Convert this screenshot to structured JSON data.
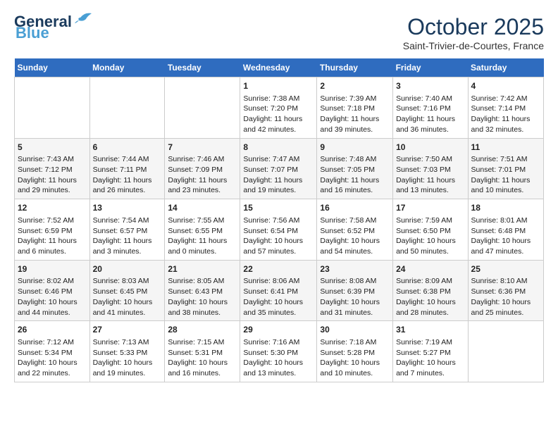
{
  "header": {
    "logo_line1": "General",
    "logo_line2": "Blue",
    "month": "October 2025",
    "location": "Saint-Trivier-de-Courtes, France"
  },
  "weekdays": [
    "Sunday",
    "Monday",
    "Tuesday",
    "Wednesday",
    "Thursday",
    "Friday",
    "Saturday"
  ],
  "weeks": [
    [
      {
        "day": "",
        "info": ""
      },
      {
        "day": "",
        "info": ""
      },
      {
        "day": "",
        "info": ""
      },
      {
        "day": "1",
        "info": "Sunrise: 7:38 AM\nSunset: 7:20 PM\nDaylight: 11 hours and 42 minutes."
      },
      {
        "day": "2",
        "info": "Sunrise: 7:39 AM\nSunset: 7:18 PM\nDaylight: 11 hours and 39 minutes."
      },
      {
        "day": "3",
        "info": "Sunrise: 7:40 AM\nSunset: 7:16 PM\nDaylight: 11 hours and 36 minutes."
      },
      {
        "day": "4",
        "info": "Sunrise: 7:42 AM\nSunset: 7:14 PM\nDaylight: 11 hours and 32 minutes."
      }
    ],
    [
      {
        "day": "5",
        "info": "Sunrise: 7:43 AM\nSunset: 7:12 PM\nDaylight: 11 hours and 29 minutes."
      },
      {
        "day": "6",
        "info": "Sunrise: 7:44 AM\nSunset: 7:11 PM\nDaylight: 11 hours and 26 minutes."
      },
      {
        "day": "7",
        "info": "Sunrise: 7:46 AM\nSunset: 7:09 PM\nDaylight: 11 hours and 23 minutes."
      },
      {
        "day": "8",
        "info": "Sunrise: 7:47 AM\nSunset: 7:07 PM\nDaylight: 11 hours and 19 minutes."
      },
      {
        "day": "9",
        "info": "Sunrise: 7:48 AM\nSunset: 7:05 PM\nDaylight: 11 hours and 16 minutes."
      },
      {
        "day": "10",
        "info": "Sunrise: 7:50 AM\nSunset: 7:03 PM\nDaylight: 11 hours and 13 minutes."
      },
      {
        "day": "11",
        "info": "Sunrise: 7:51 AM\nSunset: 7:01 PM\nDaylight: 11 hours and 10 minutes."
      }
    ],
    [
      {
        "day": "12",
        "info": "Sunrise: 7:52 AM\nSunset: 6:59 PM\nDaylight: 11 hours and 6 minutes."
      },
      {
        "day": "13",
        "info": "Sunrise: 7:54 AM\nSunset: 6:57 PM\nDaylight: 11 hours and 3 minutes."
      },
      {
        "day": "14",
        "info": "Sunrise: 7:55 AM\nSunset: 6:55 PM\nDaylight: 11 hours and 0 minutes."
      },
      {
        "day": "15",
        "info": "Sunrise: 7:56 AM\nSunset: 6:54 PM\nDaylight: 10 hours and 57 minutes."
      },
      {
        "day": "16",
        "info": "Sunrise: 7:58 AM\nSunset: 6:52 PM\nDaylight: 10 hours and 54 minutes."
      },
      {
        "day": "17",
        "info": "Sunrise: 7:59 AM\nSunset: 6:50 PM\nDaylight: 10 hours and 50 minutes."
      },
      {
        "day": "18",
        "info": "Sunrise: 8:01 AM\nSunset: 6:48 PM\nDaylight: 10 hours and 47 minutes."
      }
    ],
    [
      {
        "day": "19",
        "info": "Sunrise: 8:02 AM\nSunset: 6:46 PM\nDaylight: 10 hours and 44 minutes."
      },
      {
        "day": "20",
        "info": "Sunrise: 8:03 AM\nSunset: 6:45 PM\nDaylight: 10 hours and 41 minutes."
      },
      {
        "day": "21",
        "info": "Sunrise: 8:05 AM\nSunset: 6:43 PM\nDaylight: 10 hours and 38 minutes."
      },
      {
        "day": "22",
        "info": "Sunrise: 8:06 AM\nSunset: 6:41 PM\nDaylight: 10 hours and 35 minutes."
      },
      {
        "day": "23",
        "info": "Sunrise: 8:08 AM\nSunset: 6:39 PM\nDaylight: 10 hours and 31 minutes."
      },
      {
        "day": "24",
        "info": "Sunrise: 8:09 AM\nSunset: 6:38 PM\nDaylight: 10 hours and 28 minutes."
      },
      {
        "day": "25",
        "info": "Sunrise: 8:10 AM\nSunset: 6:36 PM\nDaylight: 10 hours and 25 minutes."
      }
    ],
    [
      {
        "day": "26",
        "info": "Sunrise: 7:12 AM\nSunset: 5:34 PM\nDaylight: 10 hours and 22 minutes."
      },
      {
        "day": "27",
        "info": "Sunrise: 7:13 AM\nSunset: 5:33 PM\nDaylight: 10 hours and 19 minutes."
      },
      {
        "day": "28",
        "info": "Sunrise: 7:15 AM\nSunset: 5:31 PM\nDaylight: 10 hours and 16 minutes."
      },
      {
        "day": "29",
        "info": "Sunrise: 7:16 AM\nSunset: 5:30 PM\nDaylight: 10 hours and 13 minutes."
      },
      {
        "day": "30",
        "info": "Sunrise: 7:18 AM\nSunset: 5:28 PM\nDaylight: 10 hours and 10 minutes."
      },
      {
        "day": "31",
        "info": "Sunrise: 7:19 AM\nSunset: 5:27 PM\nDaylight: 10 hours and 7 minutes."
      },
      {
        "day": "",
        "info": ""
      }
    ]
  ]
}
